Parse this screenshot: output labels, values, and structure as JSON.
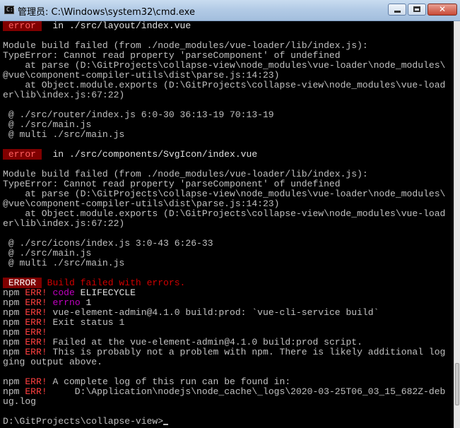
{
  "window": {
    "title": "管理员: C:\\Windows\\system32\\cmd.exe",
    "icon_name": "console-icon",
    "controls": {
      "minimize": "minimize-icon",
      "maximize": "maximize-icon",
      "close": "close-icon"
    }
  },
  "colors": {
    "background": "#000000",
    "text": "#c0c0c0",
    "error_badge_bg": "#800000",
    "error_text": "#ff4040",
    "npm_err": "#c000c0"
  },
  "terminal": {
    "block1": {
      "tag": " error ",
      "location": "  in ./src/layout/index.vue",
      "blank1": "",
      "l1": "Module build failed (from ./node_modules/vue-loader/lib/index.js):",
      "l2": "TypeError: Cannot read property 'parseComponent' of undefined",
      "l3": "    at parse (D:\\GitProjects\\collapse-view\\node_modules\\vue-loader\\node_modules\\",
      "l4": "@vue\\component-compiler-utils\\dist\\parse.js:14:23)",
      "l5": "    at Object.module.exports (D:\\GitProjects\\collapse-view\\node_modules\\vue-load",
      "l6": "er\\lib\\index.js:67:22)",
      "blank2": "",
      "r1": " @ ./src/router/index.js 6:0-30 36:13-19 70:13-19",
      "r2": " @ ./src/main.js",
      "r3": " @ multi ./src/main.js",
      "blank3": ""
    },
    "block2": {
      "tag": " error ",
      "location": "  in ./src/components/SvgIcon/index.vue",
      "blank1": "",
      "l1": "Module build failed (from ./node_modules/vue-loader/lib/index.js):",
      "l2": "TypeError: Cannot read property 'parseComponent' of undefined",
      "l3": "    at parse (D:\\GitProjects\\collapse-view\\node_modules\\vue-loader\\node_modules\\",
      "l4": "@vue\\component-compiler-utils\\dist\\parse.js:14:23)",
      "l5": "    at Object.module.exports (D:\\GitProjects\\collapse-view\\node_modules\\vue-load",
      "l6": "er\\lib\\index.js:67:22)",
      "blank2": "",
      "r1": " @ ./src/icons/index.js 3:0-43 6:26-33",
      "r2": " @ ./src/main.js",
      "r3": " @ multi ./src/main.js",
      "blank3": ""
    },
    "build": {
      "tag": " ERROR ",
      "message": " Build failed with errors."
    },
    "npm": [
      {
        "prefix": "npm ",
        "err": "ERR!",
        "rest": " ",
        "key": "code",
        "value": " ELIFECYCLE"
      },
      {
        "prefix": "npm ",
        "err": "ERR!",
        "rest": " ",
        "key": "errno",
        "value": " 1"
      },
      {
        "prefix": "npm ",
        "err": "ERR!",
        "rest": " vue-element-admin@4.1.0 build:prod: `vue-cli-service build`",
        "key": "",
        "value": ""
      },
      {
        "prefix": "npm ",
        "err": "ERR!",
        "rest": " Exit status 1",
        "key": "",
        "value": ""
      },
      {
        "prefix": "npm ",
        "err": "ERR!",
        "rest": "",
        "key": "",
        "value": ""
      },
      {
        "prefix": "npm ",
        "err": "ERR!",
        "rest": " Failed at the vue-element-admin@4.1.0 build:prod script.",
        "key": "",
        "value": ""
      },
      {
        "prefix": "npm ",
        "err": "ERR!",
        "rest": " This is probably not a problem with npm. There is likely additional log",
        "key": "",
        "value": ""
      }
    ],
    "npm_wrap": "ging output above.",
    "blank4": "",
    "npm2": [
      {
        "prefix": "npm ",
        "err": "ERR!",
        "rest": " A complete log of this run can be found in:"
      },
      {
        "prefix": "npm ",
        "err": "ERR!",
        "rest": "     D:\\Application\\nodejs\\node_cache\\_logs\\2020-03-25T06_03_15_682Z-deb"
      }
    ],
    "npm2_wrap": "ug.log",
    "blank5": "",
    "prompt": "D:\\GitProjects\\collapse-view>"
  }
}
